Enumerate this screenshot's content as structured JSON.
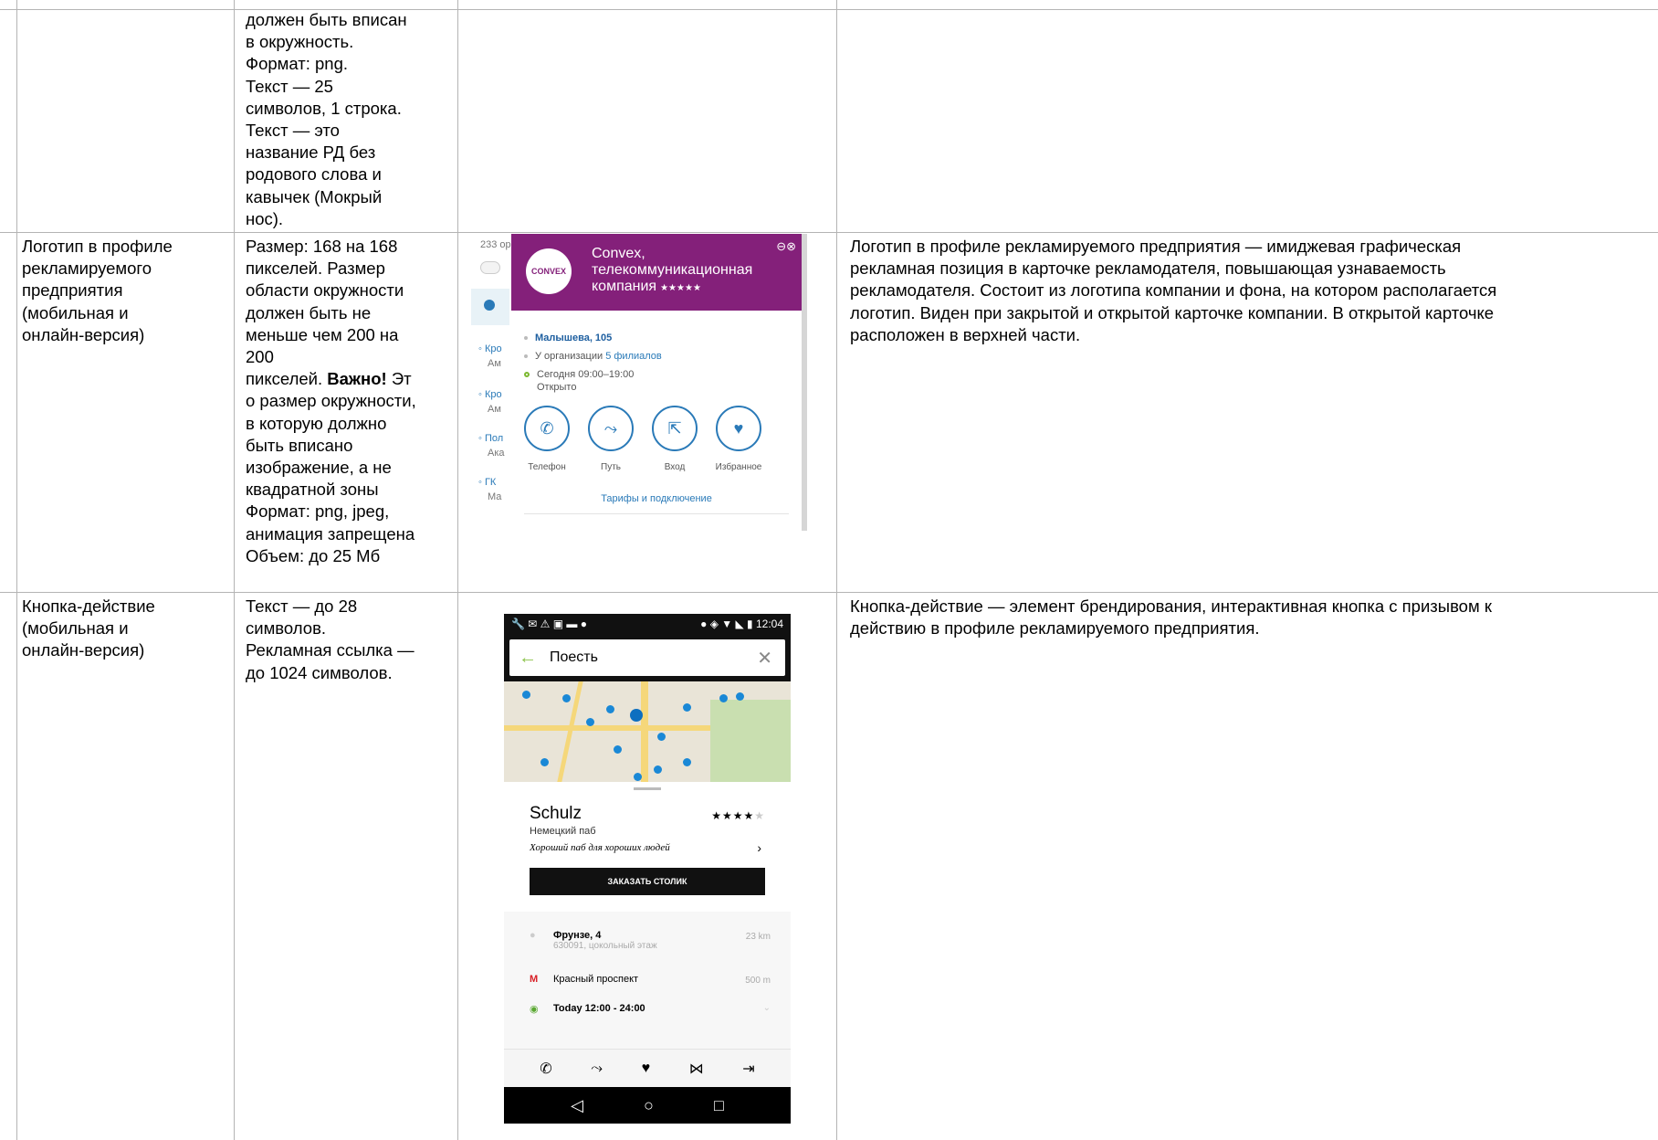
{
  "rows": [
    {
      "requirements_lines": [
        "должен быть вписан",
        "в окружность.",
        "Формат: png.",
        "Текст — 25",
        "символов, 1 строка.",
        "Текст — это",
        "название РД без",
        "родового слова и",
        "кавычек (Мокрый",
        "нос)."
      ]
    },
    {
      "name_lines": [
        "Логотип в профиле",
        "рекламируемого",
        "предприятия",
        "(мобильная и",
        "онлайн-версия)"
      ],
      "req_a": [
        "Размер: 168 на 168",
        "пикселей. Размер",
        "области окружности",
        "должен быть не",
        "меньше чем 200 на",
        "200"
      ],
      "req_b_prefix": "пикселей. ",
      "req_b_bold": "Важно!",
      "req_b_suffix": " Эт",
      "req_c": [
        "о размер окружности,",
        "в которую должно",
        "быть вписано",
        "изображение, а не",
        "квадратной зоны",
        "Формат: png, jpeg,",
        "анимация запрещена",
        "Объем: до 25 Мб"
      ],
      "description_lines": [
        "Логотип в профиле рекламируемого предприятия — имиджевая графическая",
        "рекламная позиция в карточке рекламодателя, повышающая узнаваемость",
        "рекламодателя. Состоит из логотипа компании и фона, на котором располагается",
        "логотип. Виден при закрытой и открытой карточке компании. В открытой карточке",
        "расположен в верхней части."
      ]
    },
    {
      "name_lines": [
        "Кнопка-действие",
        "(мобильная и",
        "онлайн-версия)"
      ],
      "req_lines": [
        "Текст — до 28",
        "символов.",
        "Рекламная ссылка —",
        "до 1024 символов."
      ],
      "description_lines": [
        "Кнопка-действие — элемент брендирования, интерактивная кнопка с призывом к",
        "действию в профиле рекламируемого предприятия."
      ]
    }
  ],
  "shot1": {
    "list_count": "233 ор",
    "list_items": [
      "Кро",
      "Ам",
      "Кро",
      "Ам",
      "Пол",
      "Ака",
      "ГК",
      "Ма"
    ],
    "logo_text": "CONVEX",
    "company_line1": "Convex,",
    "company_line2": "телекоммуникационная",
    "company_line3": "компания",
    "stars": "★★★★★",
    "address": "Малышева, 105",
    "branches_prefix": "У организации ",
    "branches_link": "5 филиалов",
    "hours": "Сегодня 09:00–19:00",
    "open_status": "Открыто",
    "actions": [
      "Телефон",
      "Путь",
      "Вход",
      "Избранное"
    ],
    "tariffs": "Тарифы и подключение"
  },
  "shot2": {
    "time": "12:04",
    "search_text": "Поесть",
    "place_name": "Schulz",
    "rating_on": "★★★★",
    "rating_off": "★",
    "category": "Немецкий паб",
    "slogan": "Хороший паб для хороших людей",
    "cta": "ЗАКАЗАТЬ СТОЛИК",
    "address": "Фрунзе, 4",
    "address_sub": "630091, цокольный этаж",
    "address_dist": "23 km",
    "metro": "Красный проспект",
    "metro_dist": "500 m",
    "hours": "Today 12:00 - 24:00"
  }
}
